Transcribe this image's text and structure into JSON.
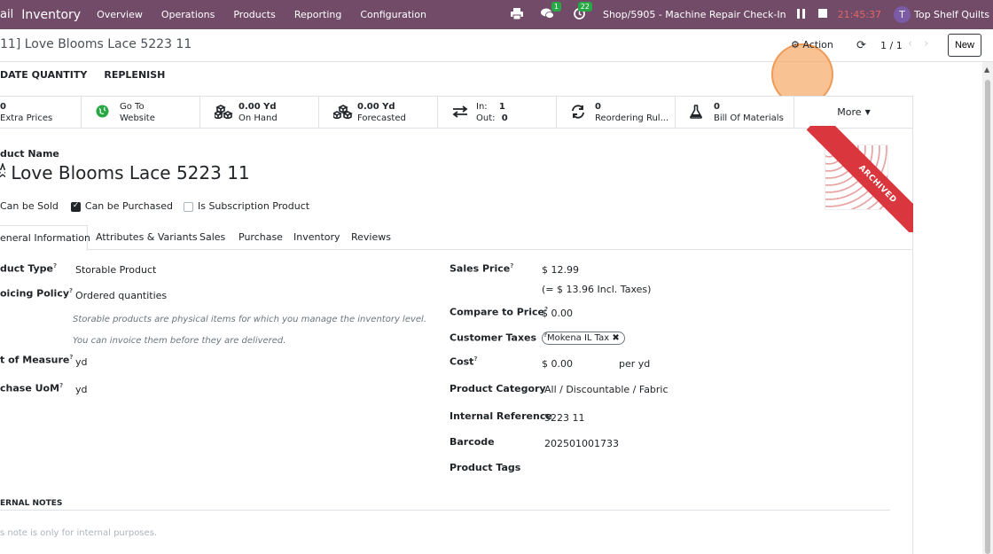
{
  "navbar": {
    "prev_app": "ail",
    "app_name": "Inventory",
    "menu": [
      "Overview",
      "Operations",
      "Products",
      "Reporting",
      "Configuration"
    ],
    "chat_badge": "1",
    "activity_badge": "22",
    "shop": "Shop/5905 - Machine Repair Check-In",
    "timer": "21:45:37",
    "avatar_letter": "T",
    "company": "Top Shelf Quilts"
  },
  "control": {
    "breadcrumb": "11] Love Blooms Lace 5223 11",
    "action_label": "Action",
    "pager": "1 / 1",
    "new_label": "New"
  },
  "statusbar": {
    "update_qty": "DATE QUANTITY",
    "replenish": "REPLENISH"
  },
  "smart_buttons": {
    "extra_prices": {
      "value": "0",
      "label": "Extra Prices"
    },
    "website": {
      "line1": "Go To",
      "line2": "Website"
    },
    "on_hand": {
      "value": "0.00 Yd",
      "label": "On Hand"
    },
    "forecasted": {
      "value": "0.00 Yd",
      "label": "Forecasted"
    },
    "in_out": {
      "in_label": "In:",
      "in_value": "1",
      "out_label": "Out:",
      "out_value": "0"
    },
    "reordering": {
      "value": "0",
      "label": "Reordering Rul..."
    },
    "bom": {
      "value": "0",
      "label": "Bill Of Materials"
    },
    "more": "More"
  },
  "ribbon": "ARCHIVED",
  "product": {
    "name_label": "duct Name",
    "name": "Love Blooms Lace 5223 11",
    "can_be_sold": "Can be Sold",
    "can_be_purchased": "Can be Purchased",
    "is_subscription": "Is Subscription Product"
  },
  "tabs": [
    "eneral Information",
    "Attributes & Variants",
    "Sales",
    "Purchase",
    "Inventory",
    "Reviews"
  ],
  "left_fields": {
    "product_type_label": "duct Type",
    "product_type": "Storable Product",
    "invoicing_label": "oicing Policy",
    "invoicing": "Ordered quantities",
    "hint1": "Storable products are physical items for which you manage the inventory level.",
    "hint2": "You can invoice them before they are delivered.",
    "uom_label": "t of Measure",
    "uom": "yd",
    "purchase_uom_label": "chase UoM",
    "purchase_uom": "yd"
  },
  "right_fields": {
    "sales_price_label": "Sales Price",
    "sales_price": "$ 12.99",
    "incl_taxes": "(= $ 13.96 Incl. Taxes)",
    "compare_label": "Compare to Price",
    "compare": "$ 0.00",
    "taxes_label": "Customer Taxes",
    "tax_tag": "Mokena IL Tax",
    "cost_label": "Cost",
    "cost": "$ 0.00",
    "per": "per yd",
    "category_label": "Product Category",
    "category": "All / Discountable / Fabric",
    "ref_label": "Internal Reference",
    "ref": "5223 11",
    "barcode_label": "Barcode",
    "barcode": "202501001733",
    "tags_label": "Product Tags"
  },
  "notes": {
    "title": "ERNAL NOTES",
    "placeholder": "s note is only for internal purposes."
  },
  "help_mark": "?"
}
